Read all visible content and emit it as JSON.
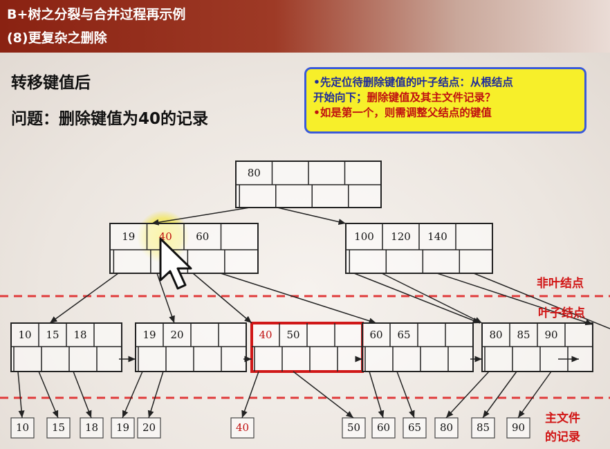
{
  "header": {
    "line1": "B+树之分裂与合并过程再示例",
    "line2": "(8)更复杂之删除"
  },
  "headings": {
    "after": "转移键值后",
    "question": "问题：删除键值为40的记录"
  },
  "callout": {
    "line1": "•先定位待删除键值的叶子结点：从根结点",
    "line2_a": "开始向下；",
    "line2_b": "删除键值及其主文件记录？",
    "line3": "•如是第一个，则需调整父结点的键值"
  },
  "labels": {
    "nonleaf": "非叶结点",
    "leaf": "叶子结点",
    "records_1": "主文件",
    "records_2": "的记录"
  },
  "tree": {
    "root": [
      "80",
      "",
      "",
      ""
    ],
    "internal_left": [
      "19",
      "40",
      "60",
      ""
    ],
    "internal_right": [
      "100",
      "120",
      "140",
      ""
    ],
    "leaves": [
      [
        "10",
        "15",
        "18",
        ""
      ],
      [
        "19",
        "20",
        "",
        ""
      ],
      [
        "40",
        "50",
        "",
        ""
      ],
      [
        "60",
        "65",
        "",
        ""
      ],
      [
        "80",
        "85",
        "90",
        ""
      ]
    ],
    "records": [
      "10",
      "15",
      "18",
      "19",
      "20",
      "40",
      "50",
      "60",
      "65",
      "80",
      "85",
      "90"
    ]
  },
  "colors": {
    "highlight_key": "#c01010",
    "selected_leaf_border": "#d01818",
    "cursor_glow": "#f2e64a",
    "divider": "#e03a3a"
  }
}
